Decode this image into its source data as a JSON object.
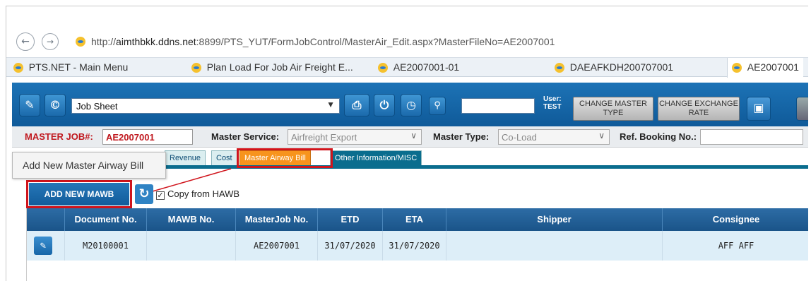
{
  "browser": {
    "url_prefix": "http://",
    "url_host": "aimthbkk.ddns.net",
    "url_rest": ":8899/PTS_YUT/FormJobControl/MasterAir_Edit.aspx?MasterFileNo=AE2007001",
    "tabs": [
      {
        "label": "PTS.NET - Main Menu"
      },
      {
        "label": "Plan Load For Job Air Freight E..."
      },
      {
        "label": "AE2007001-01"
      },
      {
        "label": "DAEAFKDH200707001"
      },
      {
        "label": "AE2007001"
      }
    ]
  },
  "header": {
    "job_select_value": "Job Sheet",
    "user_label": "User:",
    "user_name": "TEST",
    "change_master_type": "CHANGE MASTER TYPE",
    "change_exchange_rate": "CHANGE EXCHANGE RATE"
  },
  "master": {
    "job_label": "MASTER JOB#:",
    "job_value": "AE2007001",
    "service_label": "Master Service:",
    "service_value": "Airfreight Export",
    "type_label": "Master Type:",
    "type_value": "Co-Load",
    "ref_label": "Ref. Booking No.:"
  },
  "subtabs": [
    {
      "label": "Revenue"
    },
    {
      "label": "Cost"
    },
    {
      "label": "Master Airway Bill"
    },
    {
      "label": "Other Information/MISC"
    }
  ],
  "tooltip": "Add New Master Airway Bill",
  "toolbar": {
    "add_label": "ADD NEW MAWB",
    "copy_label": "Copy from HAWB"
  },
  "grid": {
    "columns": [
      "",
      "Document No.",
      "MAWB No.",
      "MasterJob No.",
      "ETD",
      "ETA",
      "Shipper",
      "Consignee"
    ],
    "rows": [
      {
        "document_no": "M20100001",
        "mawb_no": "",
        "masterjob_no": "AE2007001",
        "etd": "31/07/2020",
        "eta": "31/07/2020",
        "shipper": "",
        "consignee": "AFF AFF"
      }
    ]
  },
  "colors": {
    "header_blue": "#1d73b6",
    "active_tab": "#f7941d",
    "highlight_red": "#d0141c"
  }
}
